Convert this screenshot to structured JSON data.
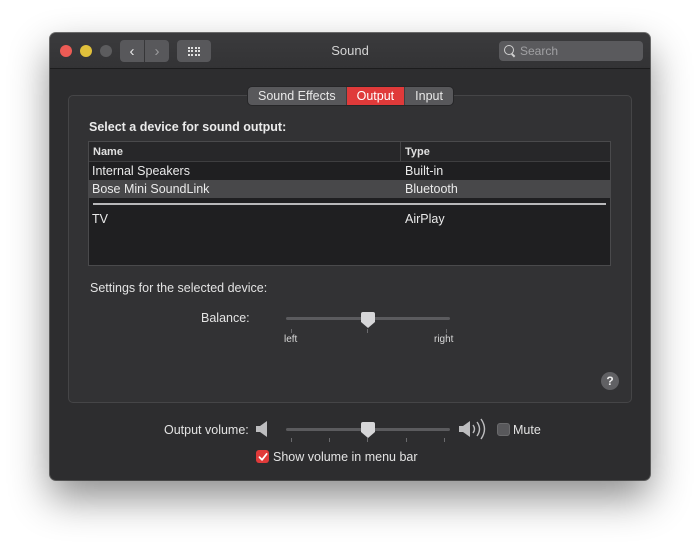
{
  "window": {
    "title": "Sound",
    "search_placeholder": "Search",
    "nav": {
      "back_icon": "chevron-left",
      "forward_icon": "chevron-right",
      "grid_icon": "show-all-grid"
    }
  },
  "tabs": [
    {
      "label": "Sound Effects",
      "active": false
    },
    {
      "label": "Output",
      "active": true
    },
    {
      "label": "Input",
      "active": false
    }
  ],
  "output": {
    "heading": "Select a device for sound output:",
    "columns": [
      "Name",
      "Type"
    ],
    "devices": [
      {
        "name": "Internal Speakers",
        "type": "Built-in",
        "selected": false
      },
      {
        "name": "Bose Mini SoundLink",
        "type": "Bluetooth",
        "selected": true
      },
      {
        "name": "TV",
        "type": "AirPlay",
        "selected": false
      }
    ],
    "settings_heading": "Settings for the selected device:",
    "balance": {
      "label": "Balance:",
      "left_label": "left",
      "right_label": "right",
      "value": 0.5
    },
    "help_label": "?"
  },
  "volume": {
    "label": "Output volume:",
    "value": 0.5,
    "mute_label": "Mute",
    "muted": false,
    "show_in_menu_bar_label": "Show volume in menu bar",
    "show_in_menu_bar": true
  },
  "colors": {
    "accent": "#e03a3a",
    "window_bg": "#2d2d2f",
    "close": "#ec5b55",
    "minimize": "#e0c03b",
    "zoom_disabled": "#5c5c5e"
  }
}
